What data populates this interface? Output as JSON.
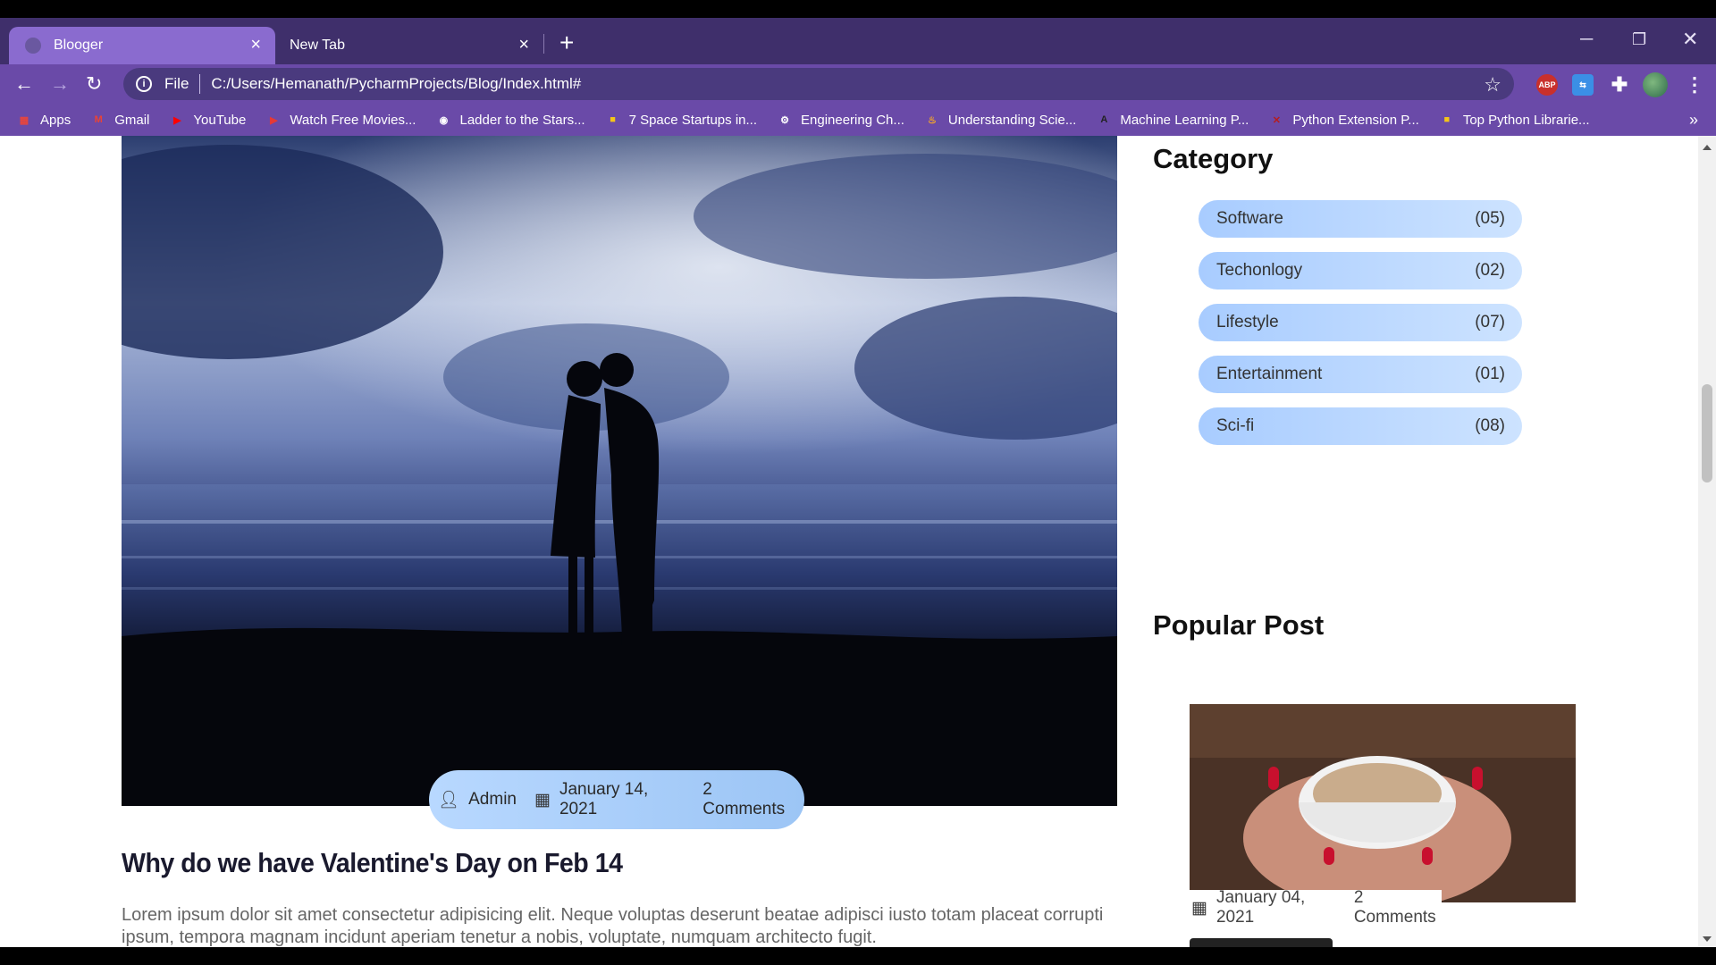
{
  "browser": {
    "tabs": [
      {
        "title": "Blooger",
        "active": true
      },
      {
        "title": "New Tab",
        "active": false
      }
    ],
    "new_tab_icon": "plus-icon",
    "window_controls": [
      "minimize-icon",
      "restore-icon",
      "close-icon"
    ],
    "address": {
      "scheme_label": "File",
      "url": "C:/Users/Hemanath/PycharmProjects/Blog/Index.html#"
    },
    "extensions": [
      {
        "name": "adblock-plus",
        "label": "ABP"
      },
      {
        "name": "translate",
        "label": ""
      },
      {
        "name": "extensions-puzzle",
        "label": ""
      },
      {
        "name": "profile-avatar",
        "label": ""
      }
    ],
    "bookmarks": [
      {
        "label": "Apps",
        "icon": "apps-grid-icon",
        "color": "#e8453c"
      },
      {
        "label": "Gmail",
        "icon": "gmail-icon",
        "color": "#ea4335"
      },
      {
        "label": "YouTube",
        "icon": "youtube-icon",
        "color": "#ff0000"
      },
      {
        "label": "Watch Free Movies...",
        "icon": "movie-play-icon",
        "color": "#e53935"
      },
      {
        "label": "Ladder to the Stars...",
        "icon": "globe-icon",
        "color": "#ffffff"
      },
      {
        "label": "7 Space Startups in...",
        "icon": "square-logo-icon",
        "color": "#f5c518"
      },
      {
        "label": "Engineering Ch...",
        "icon": "gear-icon",
        "color": "#ffffff"
      },
      {
        "label": "Understanding Scie...",
        "icon": "flame-icon",
        "color": "#f9a825"
      },
      {
        "label": "Machine Learning P...",
        "icon": "a-logo-icon",
        "color": "#222222"
      },
      {
        "label": "Python Extension P...",
        "icon": "x-circle-icon",
        "color": "#b71c1c"
      },
      {
        "label": "Top Python Librarie...",
        "icon": "square-logo-icon",
        "color": "#f5c518"
      }
    ],
    "bookmarks_overflow": "»"
  },
  "post": {
    "author": "Admin",
    "date": "January 14, 2021",
    "comments": "2 Comments",
    "title": "Why do we have Valentine's Day on Feb 14",
    "excerpt": "Lorem ipsum dolor sit amet consectetur adipisicing elit. Neque voluptas deserunt beatae adipisci iusto totam placeat corrupti ipsum, tempora magnam incidunt aperiam tenetur a nobis, voluptate, numquam architecto fugit."
  },
  "sidebar": {
    "category_heading": "Category",
    "categories": [
      {
        "name": "Software",
        "count": "(05)"
      },
      {
        "name": "Techonlogy",
        "count": "(02)"
      },
      {
        "name": "Lifestyle",
        "count": "(07)"
      },
      {
        "name": "Entertainment",
        "count": "(01)"
      },
      {
        "name": "Sci-fi",
        "count": "(08)"
      }
    ],
    "popular_heading": "Popular Post",
    "popular": {
      "date": "January 04, 2021",
      "comments": "2 Comments"
    }
  },
  "colors": {
    "tab_strip": "#3f2f6b",
    "toolbar": "#6a4aa8",
    "pill_accent": "#a8ccff"
  }
}
